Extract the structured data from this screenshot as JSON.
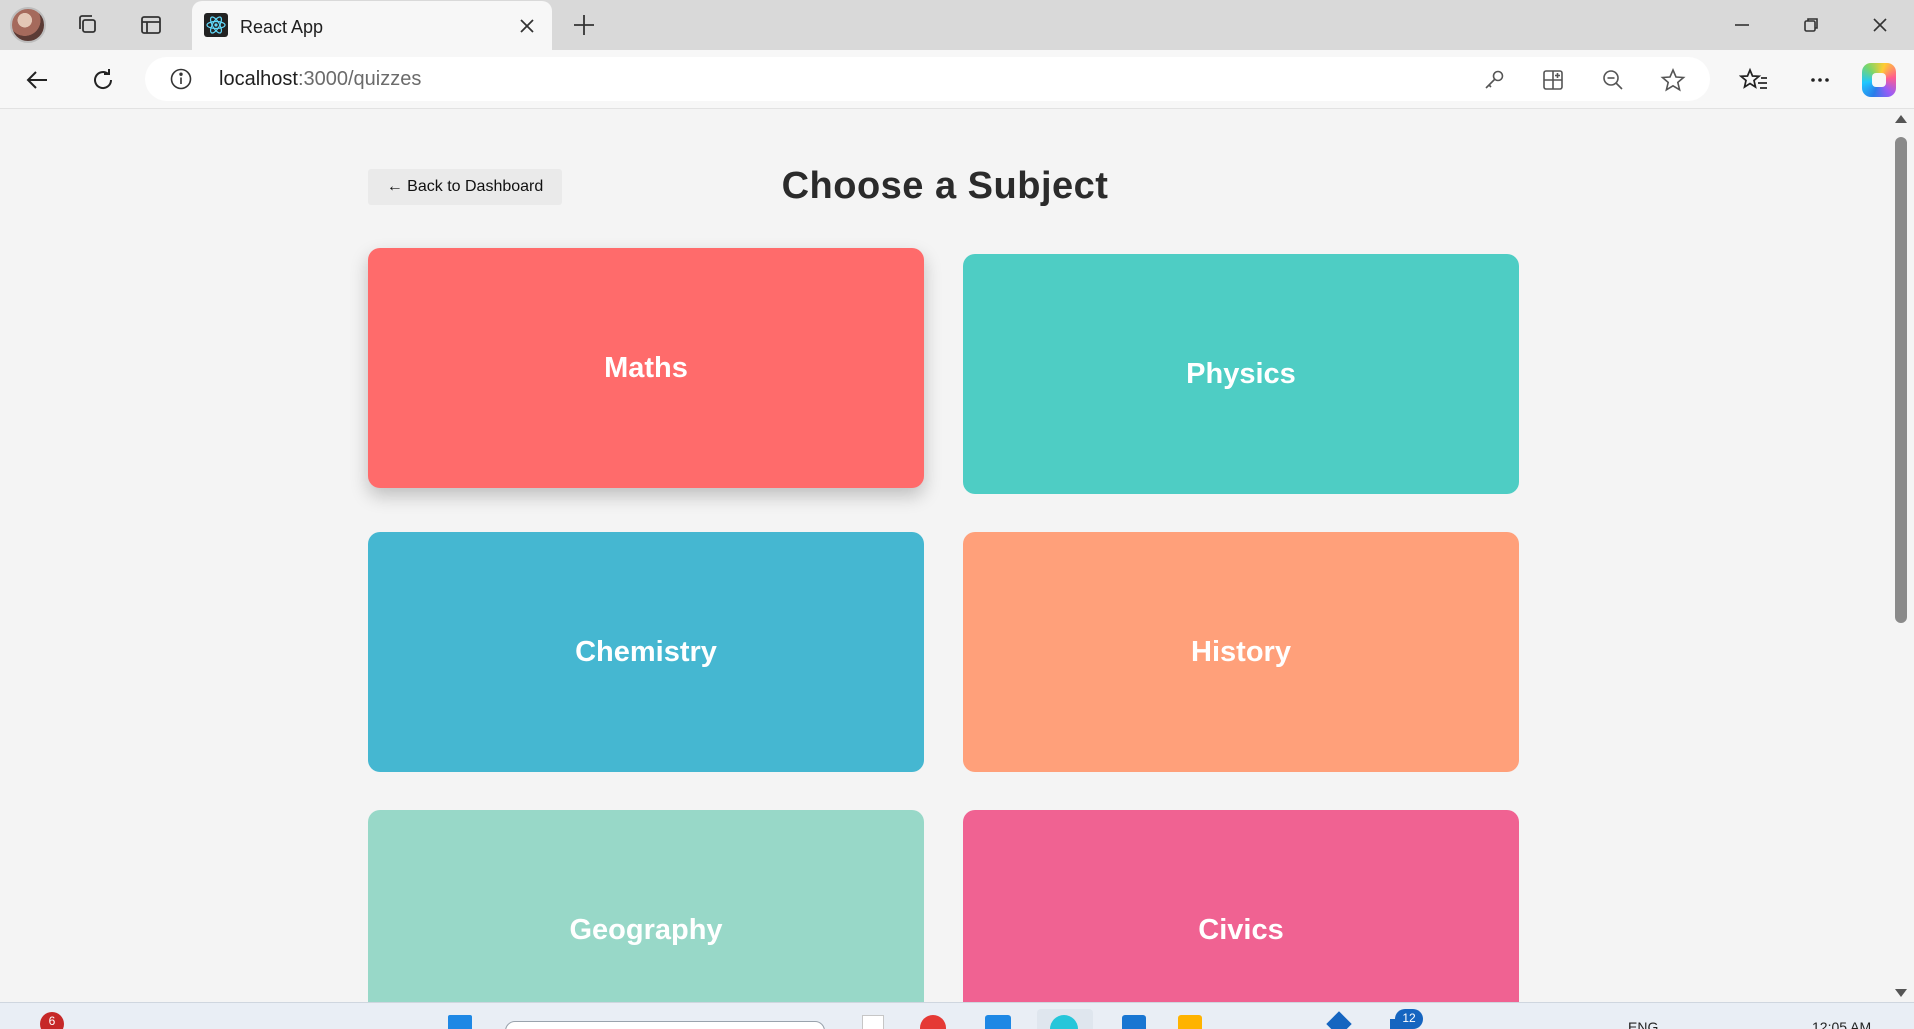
{
  "browser": {
    "tab": {
      "title": "React App"
    },
    "address": {
      "host": "localhost",
      "path": ":3000/quizzes"
    }
  },
  "page": {
    "back_button": "← Back to Dashboard",
    "title": "Choose a Subject",
    "subjects": [
      {
        "label": "Maths",
        "color": "#ff6b6b"
      },
      {
        "label": "Physics",
        "color": "#4ecdc4"
      },
      {
        "label": "Chemistry",
        "color": "#45b7d1"
      },
      {
        "label": "History",
        "color": "#ffa07a"
      },
      {
        "label": "Geography",
        "color": "#98d8c8"
      },
      {
        "label": "Civics",
        "color": "#f06292"
      }
    ]
  },
  "taskbar": {
    "notification_badge": "6",
    "widget_badge": "12",
    "language": "ENG",
    "time": "12:05 AM"
  }
}
